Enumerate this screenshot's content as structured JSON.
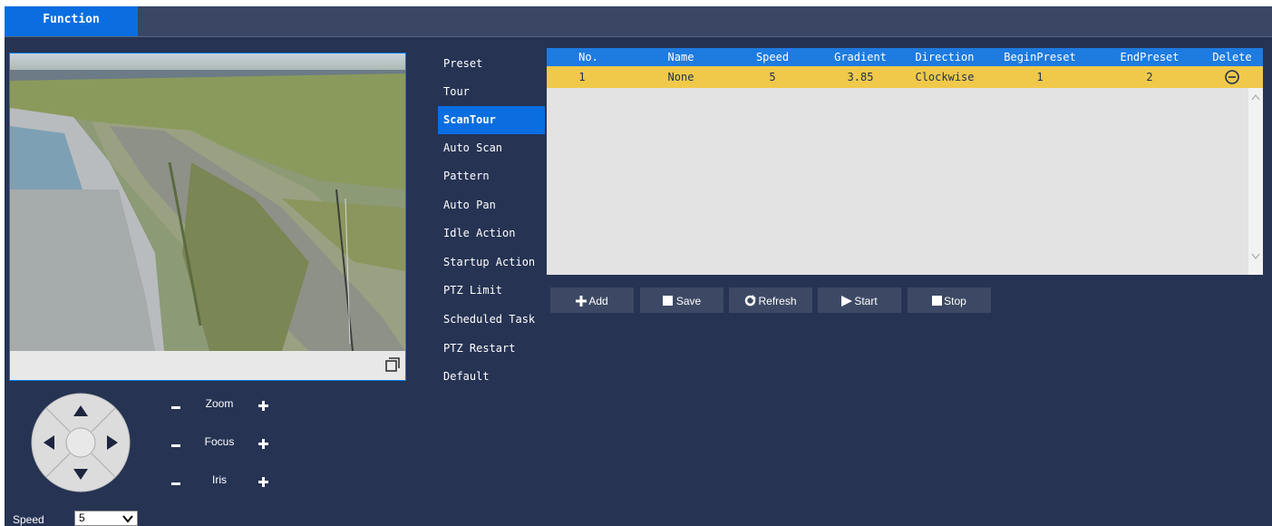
{
  "tabs": {
    "function": "Function"
  },
  "menu": [
    {
      "label": "Preset",
      "active": false
    },
    {
      "label": "Tour",
      "active": false
    },
    {
      "label": "ScanTour",
      "active": true
    },
    {
      "label": "Auto Scan",
      "active": false
    },
    {
      "label": "Pattern",
      "active": false
    },
    {
      "label": "Auto Pan",
      "active": false
    },
    {
      "label": "Idle Action",
      "active": false
    },
    {
      "label": "Startup Action",
      "active": false
    },
    {
      "label": "PTZ Limit",
      "active": false
    },
    {
      "label": "Scheduled Task",
      "active": false
    },
    {
      "label": "PTZ Restart",
      "active": false
    },
    {
      "label": "Default",
      "active": false
    }
  ],
  "table": {
    "headers": [
      "No.",
      "Name",
      "Speed",
      "Gradient",
      "Direction",
      "BeginPreset",
      "EndPreset",
      "Delete"
    ],
    "rows": [
      {
        "no": "1",
        "name": "None",
        "speed": "5",
        "gradient": "3.85",
        "direction": "Clockwise",
        "begin_preset": "1",
        "end_preset": "2"
      }
    ]
  },
  "buttons": {
    "add": "Add",
    "save": "Save",
    "refresh": "Refresh",
    "start": "Start",
    "stop": "Stop"
  },
  "ptz": {
    "zoom": "Zoom",
    "focus": "Focus",
    "iris": "Iris",
    "speed_label": "Speed",
    "speed_value": "5"
  },
  "colors": {
    "background": "#263353",
    "accent": "#0a6ee0",
    "selected_row": "#f0c94a"
  }
}
